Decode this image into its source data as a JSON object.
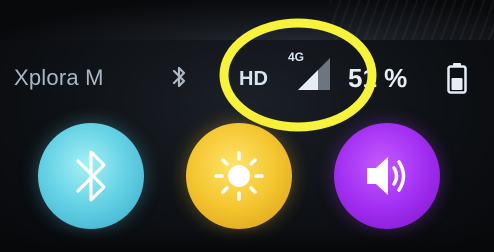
{
  "status_bar": {
    "carrier": "Xplora M",
    "bluetooth_icon": "bluetooth-icon",
    "hd_label": "HD",
    "network_type": "4G",
    "signal_icon": "cell-signal-icon",
    "battery_percent": "51 %",
    "battery_icon": "battery-icon"
  },
  "annotation": {
    "shape": "ellipse",
    "color": "#f7f23a"
  },
  "quick_toggles": [
    {
      "name": "bluetooth",
      "icon": "bluetooth-icon",
      "color": "#5fd0e4"
    },
    {
      "name": "brightness",
      "icon": "sun-icon",
      "color": "#f2c230"
    },
    {
      "name": "volume",
      "icon": "speaker-icon",
      "color": "#a02ff0"
    }
  ],
  "colors": {
    "background": "#07080b",
    "text": "#e6edf4",
    "carrier_text": "#aab6c4"
  }
}
